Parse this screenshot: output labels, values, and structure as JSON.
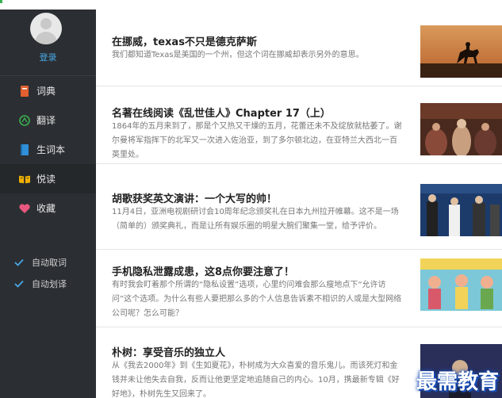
{
  "sidebar": {
    "login_label": "登录",
    "nav": [
      {
        "label": "词典",
        "icon": "dictionary-book-icon",
        "color": "#e0602f"
      },
      {
        "label": "翻译",
        "icon": "translate-icon",
        "color": "#3ab04f"
      },
      {
        "label": "生词本",
        "icon": "wordbook-icon",
        "color": "#2f8fd8"
      },
      {
        "label": "悦读",
        "icon": "reading-open-book-icon",
        "color": "#f0b000"
      },
      {
        "label": "收藏",
        "icon": "heart-icon",
        "color": "#e8577f"
      }
    ],
    "options": [
      {
        "label": "自动取词",
        "checked": true
      },
      {
        "label": "自动划译",
        "checked": true
      }
    ]
  },
  "articles": [
    {
      "title": "在挪威，texas不只是德克萨斯",
      "text": "我们都知道Texas是美国的一个州，但这个词在挪威却表示另外的意思。"
    },
    {
      "title": "名著在线阅读《乱世佳人》Chapter 17（上）",
      "text": "1864年的五月来到了，那是个又热又干燥的五月，花蕾还未不及绽放就枯萎了。谢尔曼将军指挥下的北军又一次进入佐治亚，到了多尔顿北边，在亚特兰大西北一百英里处。"
    },
    {
      "title": "胡歌获奖英文演讲：一个大写的帅！",
      "text": "11月4日，亚洲电视剧研讨会10周年纪念颁奖礼在日本九州拉开帷幕。这不是一场（简单的）颁奖典礼，而是让所有娱乐圈的明星大腕们聚集一堂，给予评价。"
    },
    {
      "title": "手机隐私泄露成患，这8点你要注意了！",
      "text": "有时我会盯着那个所谓的“隐私设置”选项，心里约问难会那么瘦地点下“允许访问”这个选项。为什么有些人要把那么多的个人信息告诉素不相识的人或是大型网络公司呢？怎么可能？"
    },
    {
      "title": "朴树：享受音乐的独立人",
      "text": "从《我去2000年》到《生如夏花》，朴树成为大众喜爱的音乐鬼儿。而该死灯和金钱并未让他失去自我，反而让他更坚定地追随自己的内心。10月，携最新专辑《好好地》，朴树先生又回来了。"
    }
  ],
  "watermark": "最需教育"
}
